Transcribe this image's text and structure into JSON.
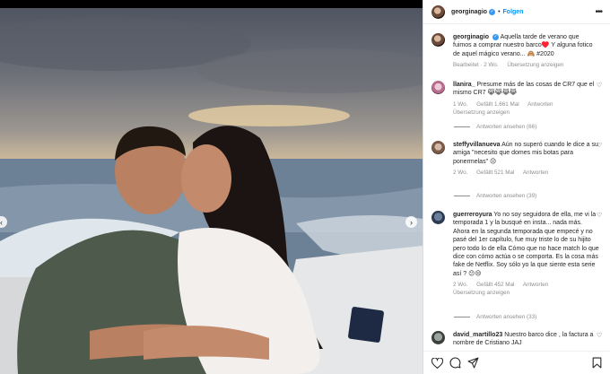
{
  "post": {
    "username": "georginagio",
    "follow_label": "Folgen",
    "caption_text": "Aquella tarde de verano que fuimos a comprar nuestro barco♥️ Y alguna fotico de aquel mágico verano... 🙈 #2020",
    "caption_meta_edited": "Bearbeitet · 2 Wo.",
    "caption_meta_translate": "Übersetzung anzeigen"
  },
  "comments": [
    {
      "username": "llanira_",
      "text": "Presume más de las cosas de CR7 que el mismo CR7 😹😹😹😹",
      "time": "1 Wo.",
      "likes": "Gefällt 1.661 Mal",
      "reply": "Antworten",
      "translate": "Übersetzung anzeigen",
      "view_replies": "Antworten ansehen (66)"
    },
    {
      "username": "steffyvillanueva",
      "text": "Aún no superó cuando le dice a su amiga \"necesito que domes mis botas para ponermelas\" 😔",
      "time": "2 Wo.",
      "likes": "Gefällt 521 Mal",
      "reply": "Antworten",
      "view_replies": "Antworten ansehen (39)"
    },
    {
      "username": "guerreroyura",
      "text": "Yo no soy seguidora de ella, me vi la temporada 1 y la busqué en insta... nada más. Ahora en la segunda temporada que empecé y no pasé del 1er capítulo, fue muy triste lo de su hijito pero todo lo de ella Cómo que no hace match lo que dice con cómo actúa o se comporta. Es la cosa más fake de Netflix. Soy sólo yo la que siente esta serie así ? 😕😒",
      "time": "2 Wo.",
      "likes": "Gefällt 452 Mal",
      "reply": "Antworten",
      "translate": "Übersetzung anzeigen",
      "view_replies": "Antworten ansehen (33)"
    },
    {
      "username": "david_martillo23",
      "text": "Nuestro barco dice , la factura a nombre de Cristiano JAJ"
    }
  ],
  "icons": {
    "heart": "heart-icon",
    "comment": "comment-icon",
    "share": "paper-plane-icon",
    "save": "bookmark-icon",
    "more": "more-options-icon",
    "verified": "verified-badge-icon"
  },
  "colors": {
    "accent": "#0095f6",
    "verified": "#3897f0",
    "muted": "#8e8e8e"
  }
}
